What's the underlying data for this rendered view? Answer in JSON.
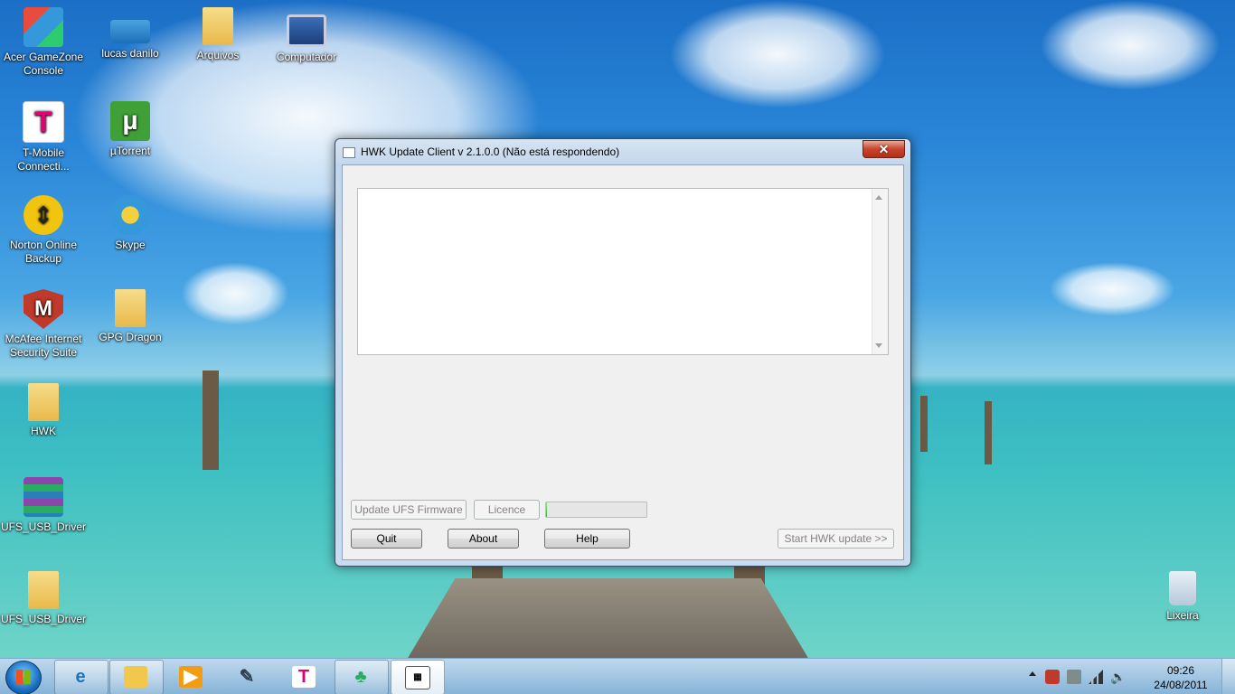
{
  "desktop": {
    "icons": [
      {
        "label": "Acer GameZone Console",
        "icon": "gamezone-icon"
      },
      {
        "label": "lucas danilo",
        "icon": "photo-icon"
      },
      {
        "label": "Arquivos",
        "icon": "folder-icon"
      },
      {
        "label": "Computador",
        "icon": "computer-icon"
      },
      {
        "label": "T-Mobile Connecti...",
        "icon": "tmobile-icon"
      },
      {
        "label": "µTorrent",
        "icon": "utorrent-icon"
      },
      {
        "label": "Norton Online Backup",
        "icon": "norton-icon"
      },
      {
        "label": "Skype",
        "icon": "skype-icon"
      },
      {
        "label": "McAfee Internet Security Suite",
        "icon": "mcafee-icon"
      },
      {
        "label": "GPG Dragon",
        "icon": "folder-icon"
      },
      {
        "label": "HWK",
        "icon": "folder-icon"
      },
      {
        "label": "UFS_USB_Driver",
        "icon": "winrar-icon"
      },
      {
        "label": "UFS_USB_Driver",
        "icon": "folder-icon"
      },
      {
        "label": "Lixeira",
        "icon": "recycle-bin-icon"
      }
    ]
  },
  "window": {
    "title": "HWK Update Client  v 2.1.0.0 (Não está respondendo)",
    "close_glyph": "✕",
    "log_text": "",
    "buttons": {
      "update_ufs": "Update UFS Firmware",
      "licence": "Licence",
      "quit": "Quit",
      "about": "About",
      "help": "Help",
      "start_update": "Start HWK update >>"
    },
    "progress": 0.01
  },
  "taskbar": {
    "pinned": [
      "internet-explorer-icon",
      "windows-explorer-icon",
      "media-player-icon",
      "paint-icon",
      "tmobile-icon",
      "messenger-icon",
      "hwk-app-icon"
    ],
    "time": "09:26",
    "date": "24/08/2011"
  },
  "colors": {
    "close_button": "#c8432b",
    "window_frame": "#c3d6ea",
    "client_bg": "#f0f0f0"
  }
}
